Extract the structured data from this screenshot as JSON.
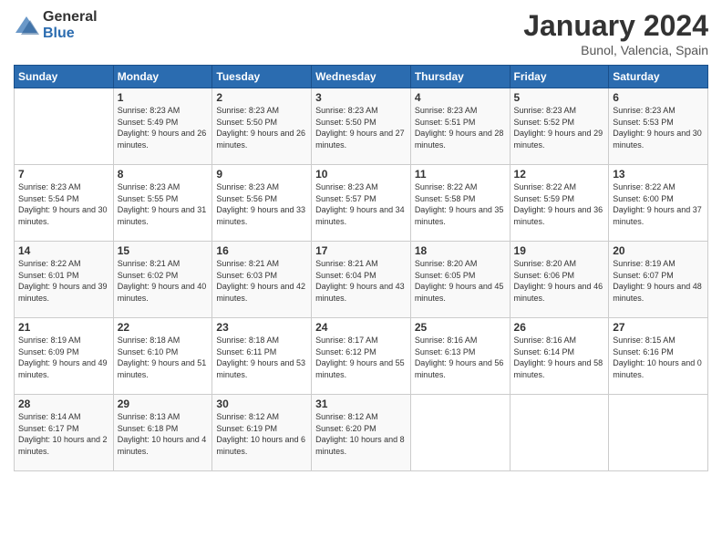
{
  "logo": {
    "general": "General",
    "blue": "Blue"
  },
  "title": "January 2024",
  "subtitle": "Bunol, Valencia, Spain",
  "days_header": [
    "Sunday",
    "Monday",
    "Tuesday",
    "Wednesday",
    "Thursday",
    "Friday",
    "Saturday"
  ],
  "weeks": [
    [
      {
        "day": "",
        "sunrise": "",
        "sunset": "",
        "daylight": ""
      },
      {
        "day": "1",
        "sunrise": "8:23 AM",
        "sunset": "5:49 PM",
        "daylight": "9 hours and 26 minutes."
      },
      {
        "day": "2",
        "sunrise": "8:23 AM",
        "sunset": "5:50 PM",
        "daylight": "9 hours and 26 minutes."
      },
      {
        "day": "3",
        "sunrise": "8:23 AM",
        "sunset": "5:50 PM",
        "daylight": "9 hours and 27 minutes."
      },
      {
        "day": "4",
        "sunrise": "8:23 AM",
        "sunset": "5:51 PM",
        "daylight": "9 hours and 28 minutes."
      },
      {
        "day": "5",
        "sunrise": "8:23 AM",
        "sunset": "5:52 PM",
        "daylight": "9 hours and 29 minutes."
      },
      {
        "day": "6",
        "sunrise": "8:23 AM",
        "sunset": "5:53 PM",
        "daylight": "9 hours and 30 minutes."
      }
    ],
    [
      {
        "day": "7",
        "sunrise": "8:23 AM",
        "sunset": "5:54 PM",
        "daylight": "9 hours and 30 minutes."
      },
      {
        "day": "8",
        "sunrise": "8:23 AM",
        "sunset": "5:55 PM",
        "daylight": "9 hours and 31 minutes."
      },
      {
        "day": "9",
        "sunrise": "8:23 AM",
        "sunset": "5:56 PM",
        "daylight": "9 hours and 33 minutes."
      },
      {
        "day": "10",
        "sunrise": "8:23 AM",
        "sunset": "5:57 PM",
        "daylight": "9 hours and 34 minutes."
      },
      {
        "day": "11",
        "sunrise": "8:22 AM",
        "sunset": "5:58 PM",
        "daylight": "9 hours and 35 minutes."
      },
      {
        "day": "12",
        "sunrise": "8:22 AM",
        "sunset": "5:59 PM",
        "daylight": "9 hours and 36 minutes."
      },
      {
        "day": "13",
        "sunrise": "8:22 AM",
        "sunset": "6:00 PM",
        "daylight": "9 hours and 37 minutes."
      }
    ],
    [
      {
        "day": "14",
        "sunrise": "8:22 AM",
        "sunset": "6:01 PM",
        "daylight": "9 hours and 39 minutes."
      },
      {
        "day": "15",
        "sunrise": "8:21 AM",
        "sunset": "6:02 PM",
        "daylight": "9 hours and 40 minutes."
      },
      {
        "day": "16",
        "sunrise": "8:21 AM",
        "sunset": "6:03 PM",
        "daylight": "9 hours and 42 minutes."
      },
      {
        "day": "17",
        "sunrise": "8:21 AM",
        "sunset": "6:04 PM",
        "daylight": "9 hours and 43 minutes."
      },
      {
        "day": "18",
        "sunrise": "8:20 AM",
        "sunset": "6:05 PM",
        "daylight": "9 hours and 45 minutes."
      },
      {
        "day": "19",
        "sunrise": "8:20 AM",
        "sunset": "6:06 PM",
        "daylight": "9 hours and 46 minutes."
      },
      {
        "day": "20",
        "sunrise": "8:19 AM",
        "sunset": "6:07 PM",
        "daylight": "9 hours and 48 minutes."
      }
    ],
    [
      {
        "day": "21",
        "sunrise": "8:19 AM",
        "sunset": "6:09 PM",
        "daylight": "9 hours and 49 minutes."
      },
      {
        "day": "22",
        "sunrise": "8:18 AM",
        "sunset": "6:10 PM",
        "daylight": "9 hours and 51 minutes."
      },
      {
        "day": "23",
        "sunrise": "8:18 AM",
        "sunset": "6:11 PM",
        "daylight": "9 hours and 53 minutes."
      },
      {
        "day": "24",
        "sunrise": "8:17 AM",
        "sunset": "6:12 PM",
        "daylight": "9 hours and 55 minutes."
      },
      {
        "day": "25",
        "sunrise": "8:16 AM",
        "sunset": "6:13 PM",
        "daylight": "9 hours and 56 minutes."
      },
      {
        "day": "26",
        "sunrise": "8:16 AM",
        "sunset": "6:14 PM",
        "daylight": "9 hours and 58 minutes."
      },
      {
        "day": "27",
        "sunrise": "8:15 AM",
        "sunset": "6:16 PM",
        "daylight": "10 hours and 0 minutes."
      }
    ],
    [
      {
        "day": "28",
        "sunrise": "8:14 AM",
        "sunset": "6:17 PM",
        "daylight": "10 hours and 2 minutes."
      },
      {
        "day": "29",
        "sunrise": "8:13 AM",
        "sunset": "6:18 PM",
        "daylight": "10 hours and 4 minutes."
      },
      {
        "day": "30",
        "sunrise": "8:12 AM",
        "sunset": "6:19 PM",
        "daylight": "10 hours and 6 minutes."
      },
      {
        "day": "31",
        "sunrise": "8:12 AM",
        "sunset": "6:20 PM",
        "daylight": "10 hours and 8 minutes."
      },
      {
        "day": "",
        "sunrise": "",
        "sunset": "",
        "daylight": ""
      },
      {
        "day": "",
        "sunrise": "",
        "sunset": "",
        "daylight": ""
      },
      {
        "day": "",
        "sunrise": "",
        "sunset": "",
        "daylight": ""
      }
    ]
  ],
  "labels": {
    "sunrise": "Sunrise:",
    "sunset": "Sunset:",
    "daylight": "Daylight:"
  }
}
